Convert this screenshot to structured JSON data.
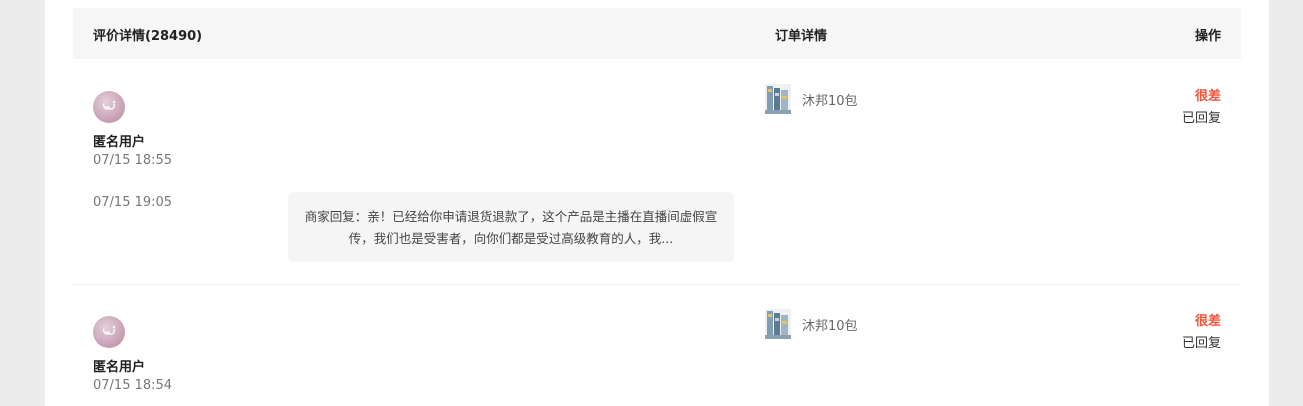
{
  "header": {
    "review_col": "评价详情(28490)",
    "order_col": "订单详情",
    "action_col": "操作"
  },
  "reviews": [
    {
      "user": "匿名用户",
      "time": "07/15 18:55",
      "reply_time": "07/15 19:05",
      "reply_text": "商家回复：亲！已经给你申请退货退款了，这个产品是主播在直播间虚假宣传，我们也是受害者，向你们都是受过高级教育的人，我...",
      "product": "沐邦10包",
      "rating": "很差",
      "status": "已回复"
    },
    {
      "user": "匿名用户",
      "time": "07/15 18:54",
      "product": "沐邦10包",
      "rating": "很差",
      "status": "已回复"
    }
  ],
  "colors": {
    "rating_bad": "#f0553c",
    "header_bg": "#f6f6f6",
    "reply_bg": "#f5f5f5"
  },
  "icons": {
    "avatar": "butterfly-avatar-icon",
    "product": "product-thumbnail"
  }
}
